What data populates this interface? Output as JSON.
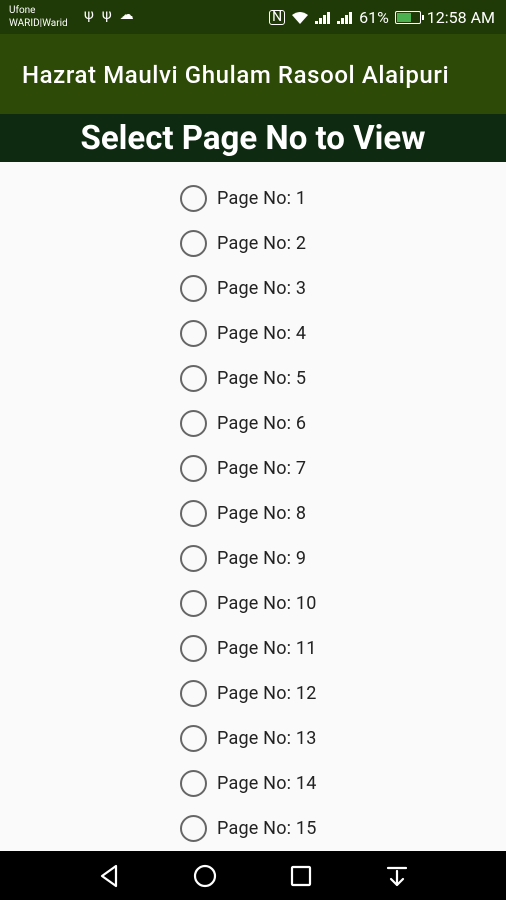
{
  "status_bar": {
    "carrier_primary": "Ufone",
    "carrier_secondary": "WARID|Warid",
    "battery_percent": "61%",
    "time": "12:58 AM",
    "icons_left": [
      "usb-icon",
      "usb-icon",
      "cloud-icon"
    ],
    "icons_right": [
      "nfc-icon",
      "wifi-icon",
      "signal-3g-icon",
      "signal-2g-icon",
      "battery-charging-icon"
    ],
    "battery_level": 0.61,
    "battery_color": "#4caf50"
  },
  "app_bar": {
    "title": "Hazrat Maulvi Ghulam Rasool Alaipuri",
    "background": "#2e4a07"
  },
  "heading": {
    "text": "Select Page No to View",
    "background": "#0e2a10"
  },
  "pages": [
    {
      "label": "Page No: 1",
      "selected": false
    },
    {
      "label": "Page No: 2",
      "selected": false
    },
    {
      "label": "Page No: 3",
      "selected": false
    },
    {
      "label": "Page No: 4",
      "selected": false
    },
    {
      "label": "Page No: 5",
      "selected": false
    },
    {
      "label": "Page No: 6",
      "selected": false
    },
    {
      "label": "Page No: 7",
      "selected": false
    },
    {
      "label": "Page No: 8",
      "selected": false
    },
    {
      "label": "Page No: 9",
      "selected": false
    },
    {
      "label": "Page No: 10",
      "selected": false
    },
    {
      "label": "Page No: 11",
      "selected": false
    },
    {
      "label": "Page No: 12",
      "selected": false
    },
    {
      "label": "Page No: 13",
      "selected": false
    },
    {
      "label": "Page No: 14",
      "selected": false
    },
    {
      "label": "Page No: 15",
      "selected": false
    }
  ],
  "nav_bar": {
    "buttons": [
      "back-icon",
      "home-icon",
      "recents-icon",
      "notifications-pull-icon"
    ]
  }
}
